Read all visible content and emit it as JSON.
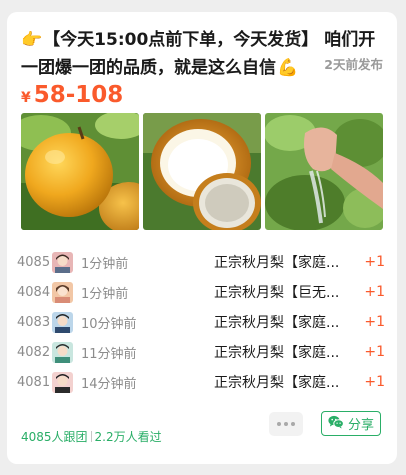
{
  "post": {
    "title": "【今天15:00点前下单，今天发货】 咱们开一团爆一团的品质，就是这么自信",
    "hand_icon": "backhand-index-pointing-right-icon",
    "arm_icon": "flexed-biceps-icon",
    "posted_time": "2天前发布",
    "price_currency": "¥",
    "price_range": "58-108"
  },
  "photos": [
    {
      "name": "photo-whole-pears",
      "icon": "golden-pear-photo"
    },
    {
      "name": "photo-cut-pear",
      "icon": "sliced-pear-photo"
    },
    {
      "name": "photo-hand-squeeze",
      "icon": "hand-squeezing-pear-photo"
    }
  ],
  "orders": [
    {
      "num": "4085",
      "time": "1分钟前",
      "product": "正宗秋月梨【家庭...",
      "qty": "+1",
      "avatar_color": "#e8b6b6"
    },
    {
      "num": "4084",
      "time": "1分钟前",
      "product": "正宗秋月梨【巨无...",
      "qty": "+1",
      "avatar_color": "#f2c7a6"
    },
    {
      "num": "4083",
      "time": "10分钟前",
      "product": "正宗秋月梨【家庭...",
      "qty": "+1",
      "avatar_color": "#bcd6ea"
    },
    {
      "num": "4082",
      "time": "11分钟前",
      "product": "正宗秋月梨【家庭...",
      "qty": "+1",
      "avatar_color": "#c9e6df"
    },
    {
      "num": "4081",
      "time": "14分钟前",
      "product": "正宗秋月梨【家庭...",
      "qty": "+1",
      "avatar_color": "#f3d1cf"
    }
  ],
  "footer": {
    "followers": "4085人跟团",
    "viewers": "2.2万人看过",
    "share_label": "分享"
  },
  "colors": {
    "accent_orange": "#fa5a2c",
    "accent_green": "#2aae67"
  }
}
